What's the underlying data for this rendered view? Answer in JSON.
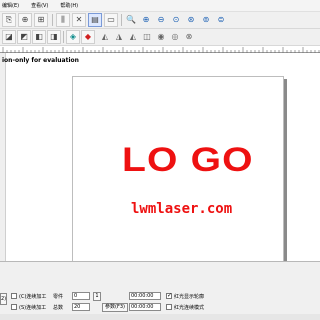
{
  "menubar": {
    "items": [
      "编辑(E)",
      "查看(V)",
      "帮助(H)"
    ]
  },
  "toolbar1": {
    "buttons": [
      {
        "name": "copy-button",
        "glyph": "⎘",
        "flat": false
      },
      {
        "name": "align-center-button",
        "glyph": "⊕",
        "flat": false
      },
      {
        "name": "position-button",
        "glyph": "⊞",
        "flat": false
      },
      {
        "name": "mirror-button",
        "glyph": "⫼",
        "flat": false
      },
      {
        "name": "tool-button",
        "glyph": "✕",
        "flat": false
      },
      {
        "name": "list-button",
        "glyph": "▤",
        "flat": false
      },
      {
        "name": "size-button",
        "glyph": "▭",
        "flat": false
      },
      {
        "name": "zoom-button",
        "glyph": "🔍",
        "flat": true
      },
      {
        "name": "zoom-in-button",
        "glyph": "⊕",
        "flat": true
      },
      {
        "name": "zoom-out-button",
        "glyph": "⊖",
        "flat": true
      },
      {
        "name": "zoom-fit-button",
        "glyph": "⊙",
        "flat": true
      },
      {
        "name": "zoom-all-button",
        "glyph": "⊛",
        "flat": true
      },
      {
        "name": "zoom-page-button",
        "glyph": "⊚",
        "flat": true
      },
      {
        "name": "zoom-select-button",
        "glyph": "⊜",
        "flat": true
      }
    ]
  },
  "toolbar2": {
    "buttons": [
      {
        "name": "node-button",
        "glyph": "◪",
        "flat": false
      },
      {
        "name": "shape-button",
        "glyph": "◩",
        "flat": false
      },
      {
        "name": "lock-button",
        "glyph": "◧",
        "flat": false
      },
      {
        "name": "group-button",
        "glyph": "◨",
        "flat": false
      },
      {
        "name": "fill-button",
        "glyph": "◈",
        "flat": false
      },
      {
        "name": "color-button",
        "glyph": "◆",
        "flat": false
      },
      {
        "name": "flip-h-button",
        "glyph": "◭",
        "flat": true
      },
      {
        "name": "flip-v-button",
        "glyph": "◮",
        "flat": true
      },
      {
        "name": "rotate-button",
        "glyph": "◭",
        "flat": true
      },
      {
        "name": "array-button",
        "glyph": "◫",
        "flat": true
      },
      {
        "name": "weld-button",
        "glyph": "◉",
        "flat": true
      },
      {
        "name": "trim-button",
        "glyph": "◎",
        "flat": true
      },
      {
        "name": "intersect-button",
        "glyph": "⊗",
        "flat": true
      }
    ]
  },
  "canvas": {
    "evaluation_text": "ion-only for evaluation",
    "logo_text": "LO GO",
    "site_text": "lwmlaser.com",
    "text_color": "#ee1111"
  },
  "bottom_panel": {
    "left_button": "2)",
    "continuous_label": "(C)连续加工",
    "continuous_label_2": "(S)连续加工",
    "count_label": "零件",
    "count_value": "0",
    "count_button": "1",
    "times_label": "总数",
    "times_value": "20",
    "time1": "00:00:00",
    "time2": "00:00:00",
    "start_button": "参数(F3)",
    "red_light_check": "✓",
    "red_light_label": "红光显示轮廓",
    "red_light_label_2": "红光连续模式"
  }
}
